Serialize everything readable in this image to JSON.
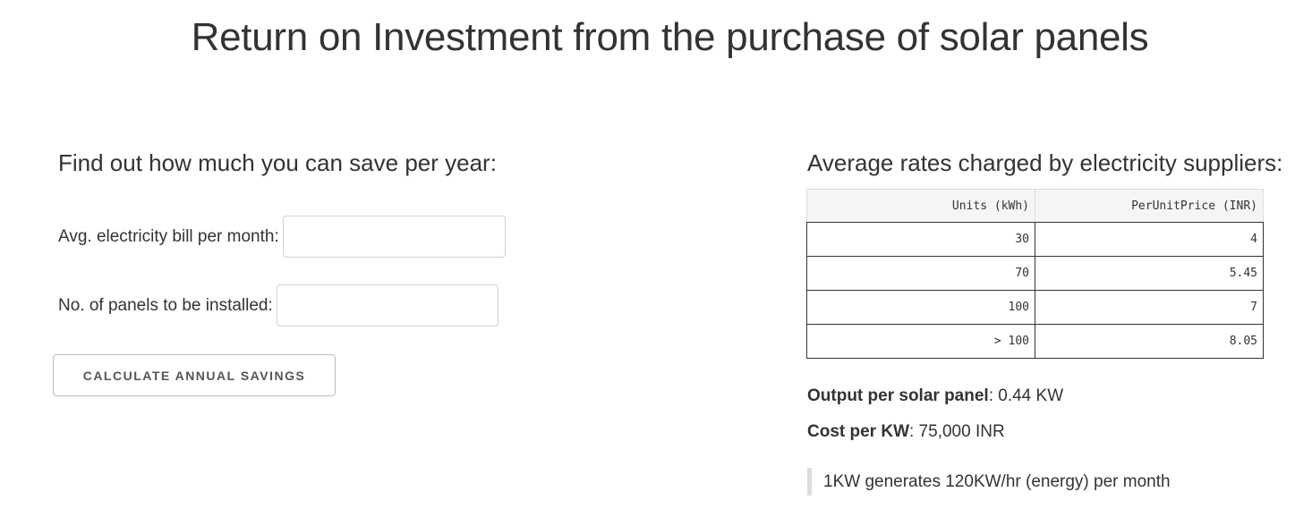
{
  "page": {
    "title": "Return on Investment from the purchase of solar panels"
  },
  "calculator": {
    "heading": "Find out how much you can save per year:",
    "bill_label": "Avg. electricity bill per month:",
    "bill_value": "",
    "panels_label": "No. of panels to be installed:",
    "panels_value": "",
    "button_label": "Calculate Annual Savings"
  },
  "rates": {
    "heading": "Average rates charged by electricity suppliers:",
    "columns": [
      "Units (kWh)",
      "PerUnitPrice (INR)"
    ],
    "rows": [
      [
        "30",
        "4"
      ],
      [
        "70",
        "5.45"
      ],
      [
        "100",
        "7"
      ],
      [
        "> 100",
        "8.05"
      ]
    ]
  },
  "info": {
    "output_label": "Output per solar panel",
    "output_value": ": 0.44 KW",
    "cost_label": "Cost per KW",
    "cost_value": ": 75,000 INR",
    "note": "1KW generates 120KW/hr (energy) per month"
  },
  "colors": {
    "text": "#333333",
    "border": "#d1d1d1",
    "quote_bar": "#dddddd"
  }
}
